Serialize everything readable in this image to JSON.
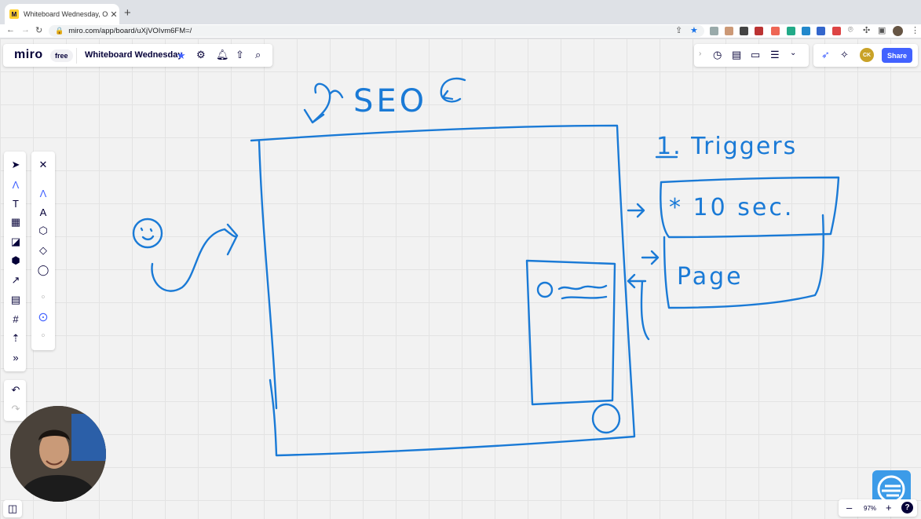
{
  "browser": {
    "tab_title": "Whiteboard Wednesday, Online",
    "url": "miro.com/app/board/uXjVOIvm6FM=/",
    "favicon_label": "M"
  },
  "header": {
    "logo": "miro",
    "plan": "free",
    "board_name": "Whiteboard Wednesday"
  },
  "collab": {
    "share_label": "Share",
    "avatar_initials": "CK"
  },
  "zoom": {
    "level": "97%",
    "minus": "–",
    "plus": "+",
    "help": "?"
  },
  "sketch_text": {
    "seo": "SEO",
    "triggers": "1. Triggers",
    "ten_sec": "* 10 sec.",
    "page": "Page"
  },
  "colors": {
    "ink": "#1a7ad6",
    "accent": "#4262ff",
    "brand": "#ffd02f"
  }
}
